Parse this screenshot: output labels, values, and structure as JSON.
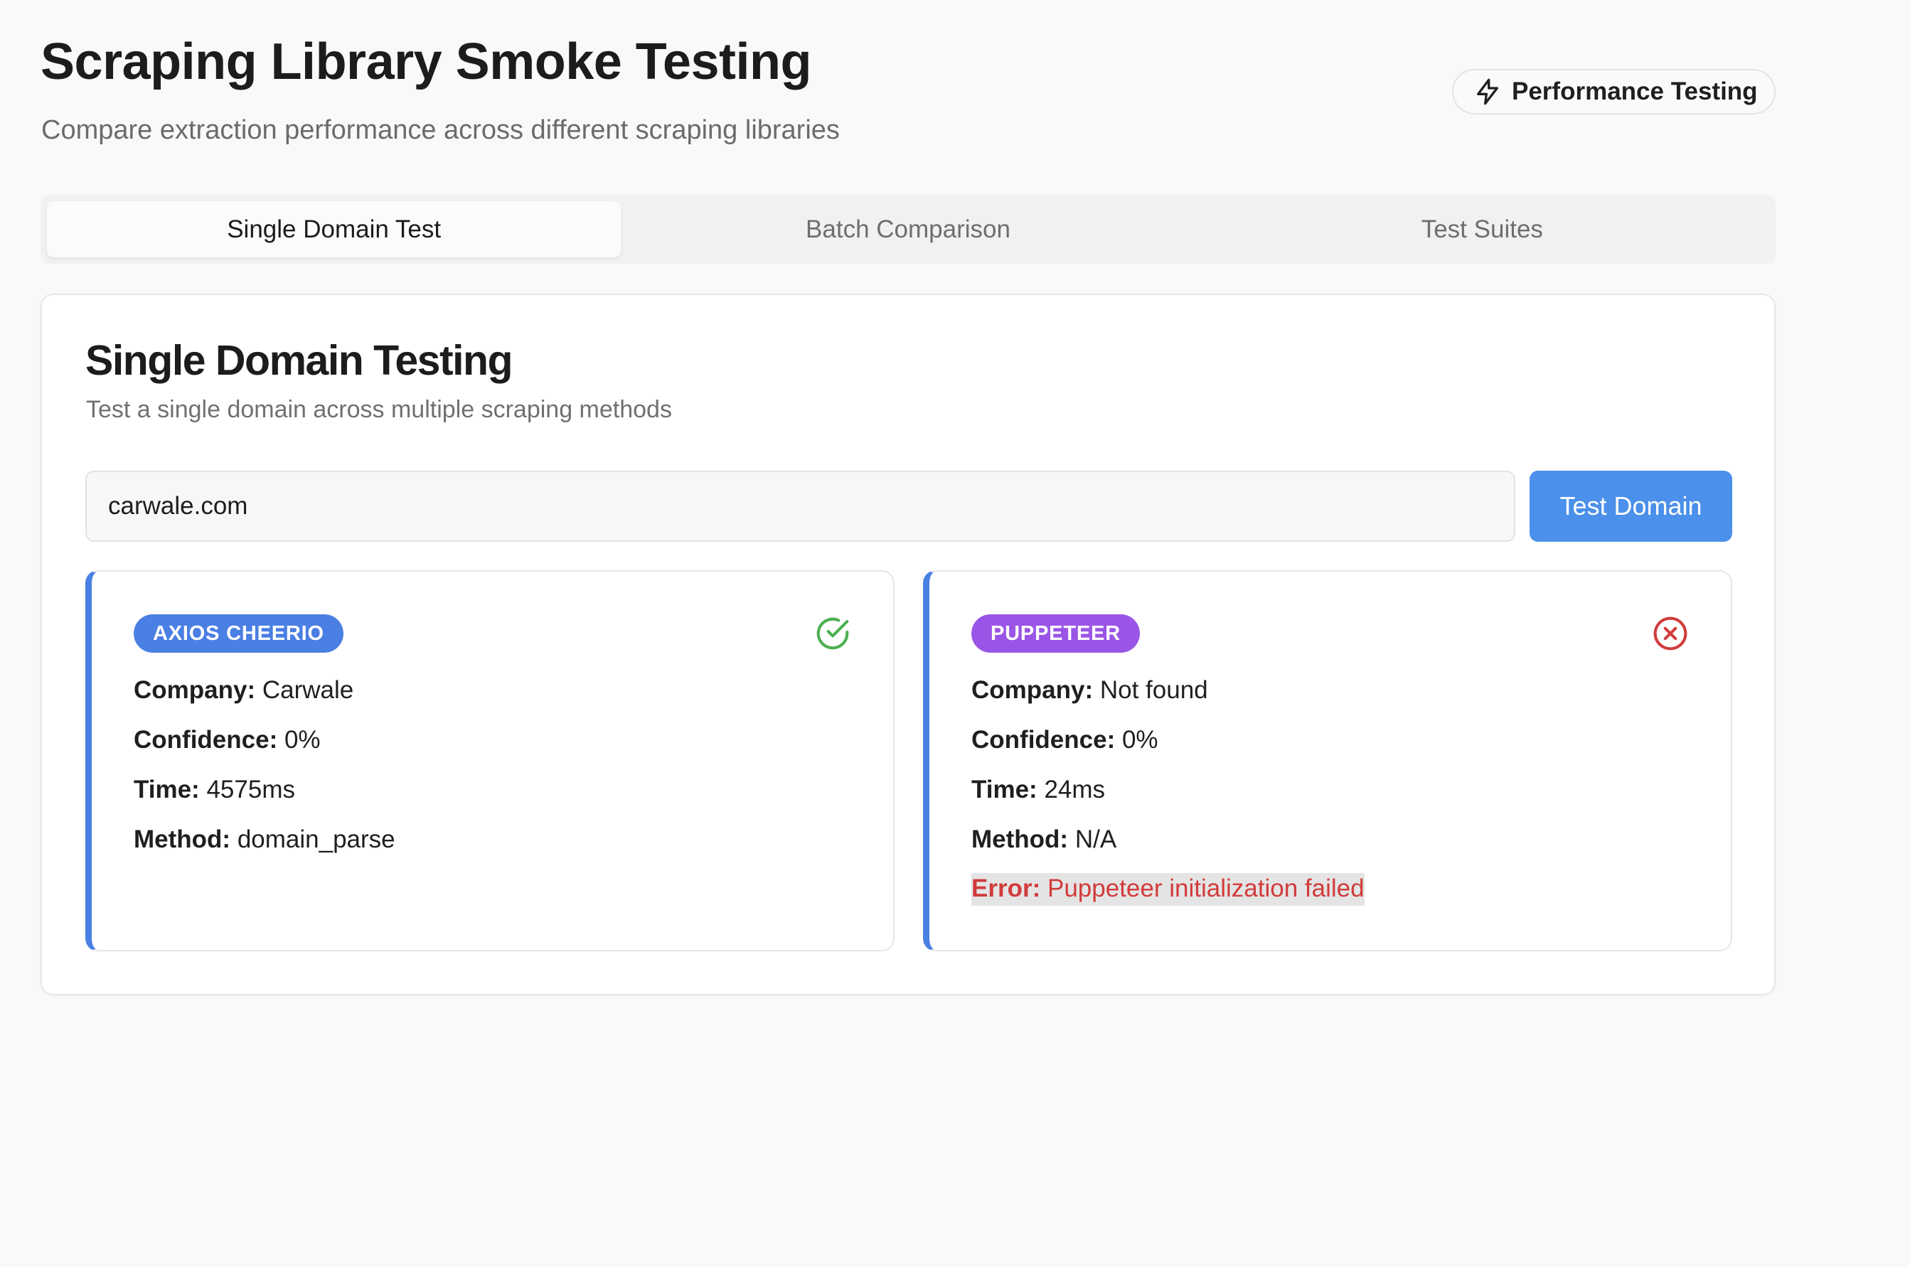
{
  "header": {
    "title": "Scraping Library Smoke Testing",
    "subtitle": "Compare extraction performance across different scraping libraries",
    "badge_label": "Performance Testing",
    "badge_icon": "lightning-icon"
  },
  "tabs": [
    {
      "label": "Single Domain Test",
      "active": true
    },
    {
      "label": "Batch Comparison",
      "active": false
    },
    {
      "label": "Test Suites",
      "active": false
    }
  ],
  "panel": {
    "title": "Single Domain Testing",
    "subtitle": "Test a single domain across multiple scraping methods",
    "domain_input_value": "carwale.com",
    "test_button_label": "Test Domain"
  },
  "results": [
    {
      "library": "AXIOS CHEERIO",
      "badge_color": "#4a7fe3",
      "status": "success",
      "status_icon": "check-circle-icon",
      "status_color": "#4caf50",
      "company_label": "Company:",
      "company_value": "Carwale",
      "confidence_label": "Confidence:",
      "confidence_value": "0%",
      "time_label": "Time:",
      "time_value": "4575ms",
      "method_label": "Method:",
      "method_value": "domain_parse"
    },
    {
      "library": "PUPPETEER",
      "badge_color": "#9a55e6",
      "status": "failed",
      "status_icon": "x-circle-icon",
      "status_color": "#d23b3b",
      "company_label": "Company:",
      "company_value": "Not found",
      "confidence_label": "Confidence:",
      "confidence_value": "0%",
      "time_label": "Time:",
      "time_value": "24ms",
      "method_label": "Method:",
      "method_value": "N/A",
      "error_label": "Error:",
      "error_value": "Puppeteer initialization failed"
    }
  ],
  "colors": {
    "accent_blue": "#4b90ea",
    "card_border_accent": "#4a7fe3",
    "error_red": "#d23b3b",
    "success_green": "#4caf50"
  }
}
